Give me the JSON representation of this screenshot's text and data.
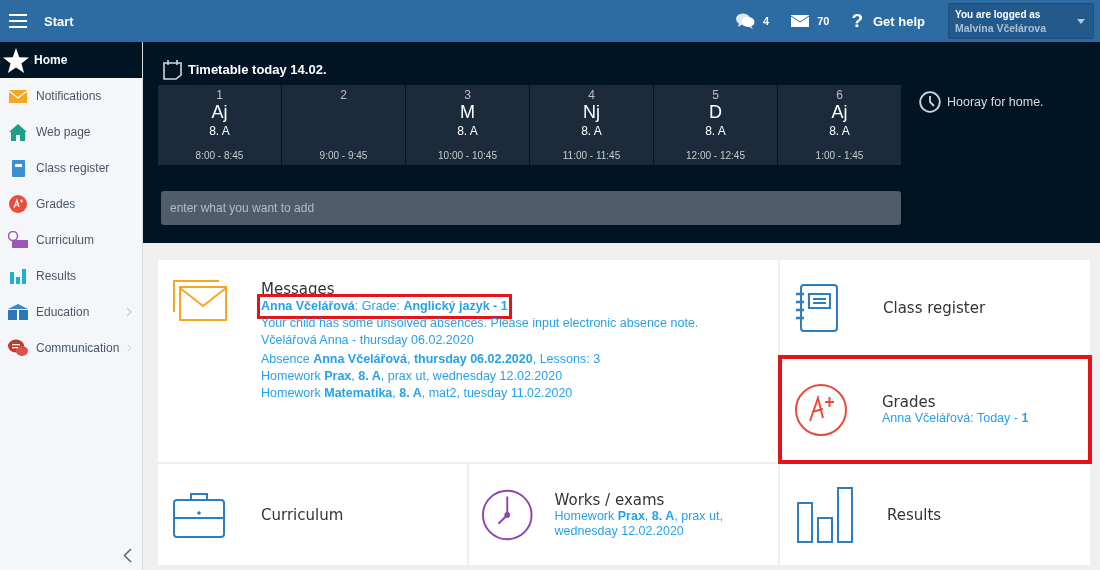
{
  "topbar": {
    "title": "Start",
    "chat_count": "4",
    "mail_count": "70",
    "help_glyph": "?",
    "help_label": "Get help",
    "user": {
      "label": "You are logged as",
      "name": "Malvína Včelárova"
    }
  },
  "sidebar": {
    "items": [
      {
        "label": "Home",
        "selected": true,
        "submenu": false
      },
      {
        "label": "Notifications",
        "selected": false,
        "submenu": false
      },
      {
        "label": "Web page",
        "selected": false,
        "submenu": false
      },
      {
        "label": "Class register",
        "selected": false,
        "submenu": false
      },
      {
        "label": "Grades",
        "selected": false,
        "submenu": false
      },
      {
        "label": "Curriculum",
        "selected": false,
        "submenu": false
      },
      {
        "label": "Results",
        "selected": false,
        "submenu": false
      },
      {
        "label": "Education",
        "selected": false,
        "submenu": true
      },
      {
        "label": "Communication",
        "selected": false,
        "submenu": true
      }
    ]
  },
  "timetable": {
    "title": "Timetable today 14.02.",
    "lessons": [
      {
        "number": "1",
        "subject": "Aj",
        "class": "8. A",
        "time": "8:00 - 8:45"
      },
      {
        "number": "2",
        "time": "9:00 - 9:45"
      },
      {
        "number": "3",
        "subject": "M",
        "class": "8. A",
        "time": "10:00 - 10:45"
      },
      {
        "number": "4",
        "subject": "Nj",
        "class": "8. A",
        "time": "11:00 - 11:45"
      },
      {
        "number": "5",
        "subject": "D",
        "class": "8. A",
        "time": "12:00 - 12:45"
      },
      {
        "number": "6",
        "subject": "Aj",
        "class": "8. A",
        "time": "1:00 - 1:45"
      }
    ],
    "add_field": {
      "placeholder": "enter what you want to add"
    },
    "note": "Hooray for home."
  },
  "tiles": [
    {
      "kind": "messages",
      "title": "Messages",
      "highlighted": false,
      "items": [
        {
          "text": "**Anna Včelářová**: Grade: **Anglický jazyk - 1**",
          "highlighted": true
        },
        {
          "text": "Your child has some unsolved absences. Please input electronic absence note.",
          "highlighted": false
        },
        {
          "text": "Včelářová Anna - thursday 06.02.2020",
          "highlighted": false
        },
        {
          "text": "Absence **Anna Včelářová**, **thursday 06.02.2020**, Lessons: 3",
          "highlighted": false
        },
        {
          "text": "Homework **Prax**, **8. A**, prax ut, wednesday 12.02.2020",
          "highlighted": false
        },
        {
          "text": "Homework **Matematika**, **8. A**, mat2, tuesday 11.02.2020",
          "highlighted": false
        }
      ]
    },
    {
      "kind": "link",
      "title": "Class register",
      "highlighted": false
    },
    {
      "kind": "link",
      "title": "Grades",
      "subtitle": "Anna Včelářová: Today - **1**",
      "highlighted": true
    },
    {
      "kind": "link",
      "title": "Curriculum",
      "highlighted": false
    },
    {
      "kind": "link",
      "title": "Works / exams",
      "subtitle": "Homework **Prax**, **8. A**, prax ut, wednesday 12.02.2020",
      "highlighted": false
    },
    {
      "kind": "link",
      "title": "Results",
      "highlighted": false
    }
  ]
}
